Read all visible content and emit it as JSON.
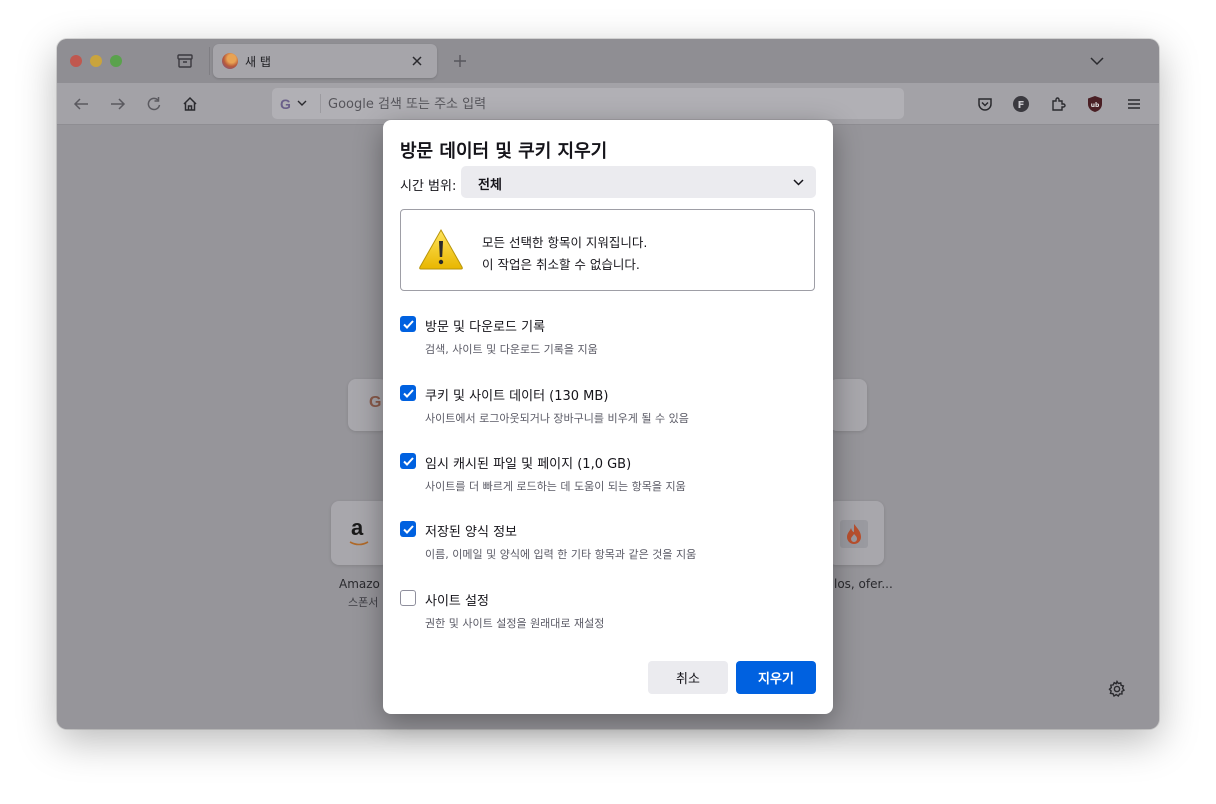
{
  "browser": {
    "tab": {
      "title": "새 탭"
    },
    "urlbar": {
      "placeholder": "Google 검색 또는 주소 입력",
      "engine_letter": "G"
    }
  },
  "shortcuts": [
    {
      "label": "Amazo",
      "sublabel": "스폰서"
    },
    {
      "label": "los, ofer..."
    }
  ],
  "dialog": {
    "title": "방문 데이터 및 쿠키 지우기",
    "time_range_label": "시간 범위:",
    "time_range_value": "전체",
    "warning": {
      "line1": "모든 선택한 항목이 지워집니다.",
      "line2": "이 작업은 취소할 수 없습니다."
    },
    "options": [
      {
        "label": "방문 및 다운로드 기록",
        "description": "검색, 사이트 및 다운로드 기록을 지움",
        "checked": true
      },
      {
        "label": "쿠키 및 사이트 데이터 (130 MB)",
        "description": "사이트에서 로그아웃되거나 장바구니를 비우게 될 수 있음",
        "checked": true
      },
      {
        "label": "임시 캐시된 파일 및 페이지 (1,0 GB)",
        "description": "사이트를 더 빠르게 로드하는 데 도움이 되는 항목을 지움",
        "checked": true
      },
      {
        "label": "저장된 양식 정보",
        "description": "이름, 이메일 및 양식에 입력 한 기타 항목과 같은 것을 지움",
        "checked": true
      },
      {
        "label": "사이트 설정",
        "description": "권한 및 사이트 설정을 원래대로 재설정",
        "checked": false
      }
    ],
    "cancel_label": "취소",
    "clear_label": "지우기"
  },
  "colors": {
    "accent": "#0061e0",
    "overlay": "#96959a"
  }
}
